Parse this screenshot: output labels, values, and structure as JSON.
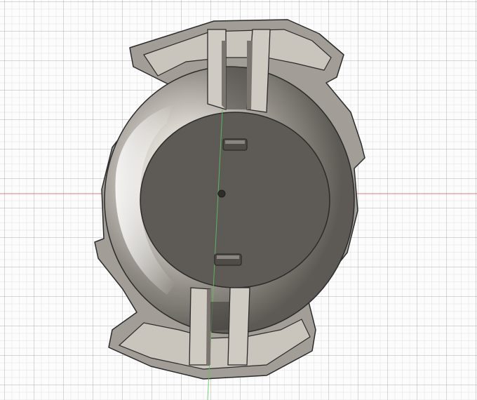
{
  "viewport": {
    "grid": true,
    "origin_axes": {
      "x_axis_color": "#e06060",
      "y_axis_color": "#5cc45c"
    }
  },
  "model": {
    "kind": "3d-printed holder body",
    "body_color": "#6a6762",
    "rim_top_color": "#a39f98",
    "wall_side_color": "#cfcac2",
    "edge_color": "#2b2b2b",
    "floor_color": "#5e5b57",
    "highlight_color": "#ffffff",
    "features": [
      "outer-shell",
      "inner-floor-disc",
      "top-notch-slots",
      "bottom-notch-slots",
      "rectangular-pegs",
      "center-hole"
    ]
  }
}
